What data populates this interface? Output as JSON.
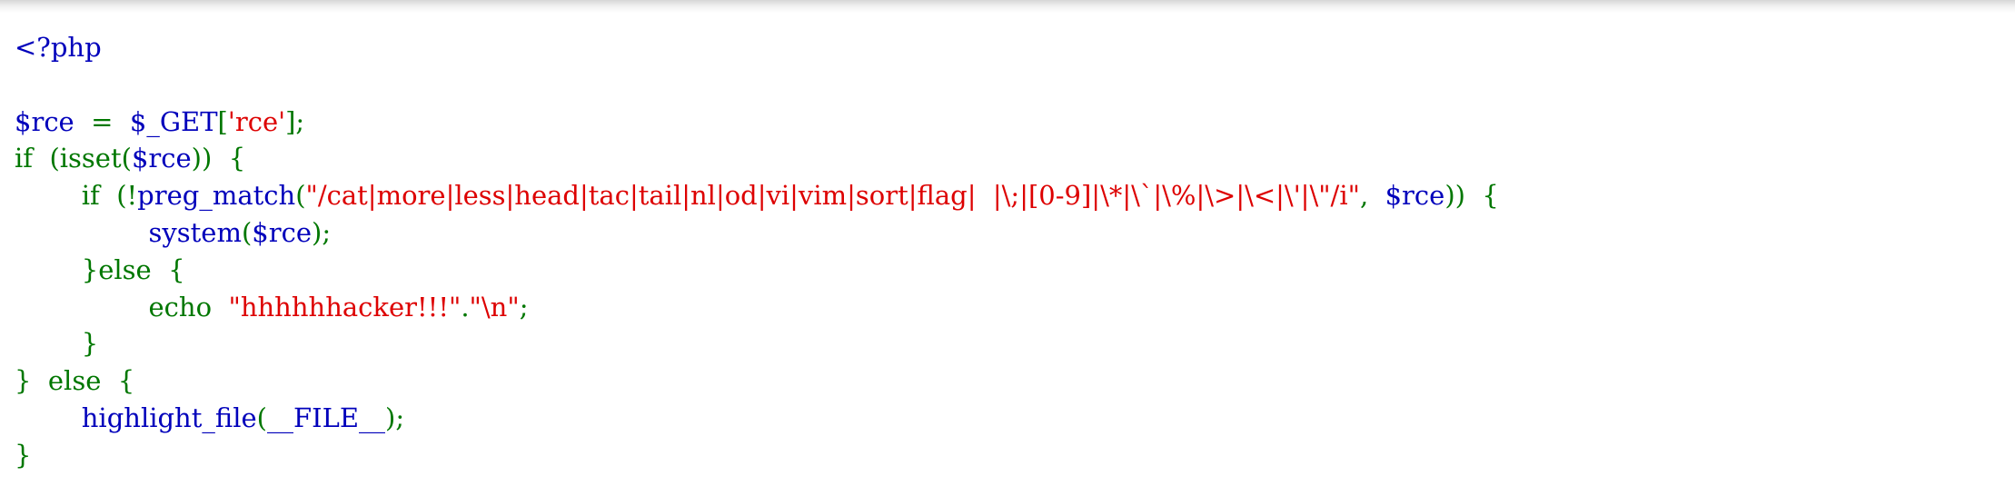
{
  "colors": {
    "default": "#0000BB",
    "keyword": "#007700",
    "string": "#DD0000"
  },
  "code": {
    "lines": [
      [
        {
          "text": "<?php",
          "type": "default"
        }
      ],
      [],
      [
        {
          "text": "$rce  ",
          "type": "default"
        },
        {
          "text": "=  ",
          "type": "keyword"
        },
        {
          "text": "$_GET",
          "type": "default"
        },
        {
          "text": "[",
          "type": "keyword"
        },
        {
          "text": "'rce'",
          "type": "string"
        },
        {
          "text": "];",
          "type": "keyword"
        }
      ],
      [
        {
          "text": "if  (isset(",
          "type": "keyword"
        },
        {
          "text": "$rce",
          "type": "default"
        },
        {
          "text": "))  {",
          "type": "keyword"
        }
      ],
      [
        {
          "text": "        if  (!",
          "type": "keyword"
        },
        {
          "text": "preg_match",
          "type": "default"
        },
        {
          "text": "(",
          "type": "keyword"
        },
        {
          "text": "\"/cat|more|less|head|tac|tail|nl|od|vi|vim|sort|flag|  |\\;|[0-9]|\\*|\\`|\\%|\\>|\\<|\\'|\\\"/i\"",
          "type": "string"
        },
        {
          "text": ",  ",
          "type": "keyword"
        },
        {
          "text": "$rce",
          "type": "default"
        },
        {
          "text": "))  {",
          "type": "keyword"
        }
      ],
      [
        {
          "text": "                ",
          "type": "keyword"
        },
        {
          "text": "system",
          "type": "default"
        },
        {
          "text": "(",
          "type": "keyword"
        },
        {
          "text": "$rce",
          "type": "default"
        },
        {
          "text": ");",
          "type": "keyword"
        }
      ],
      [
        {
          "text": "        }else  {",
          "type": "keyword"
        }
      ],
      [
        {
          "text": "                echo  ",
          "type": "keyword"
        },
        {
          "text": "\"hhhhhhacker!!!\"",
          "type": "string"
        },
        {
          "text": ".",
          "type": "keyword"
        },
        {
          "text": "\"\\n\"",
          "type": "string"
        },
        {
          "text": ";",
          "type": "keyword"
        }
      ],
      [
        {
          "text": "        }",
          "type": "keyword"
        }
      ],
      [
        {
          "text": "}  else  {",
          "type": "keyword"
        }
      ],
      [
        {
          "text": "        ",
          "type": "keyword"
        },
        {
          "text": "highlight_file",
          "type": "default"
        },
        {
          "text": "(",
          "type": "keyword"
        },
        {
          "text": "__FILE__",
          "type": "default"
        },
        {
          "text": ");",
          "type": "keyword"
        }
      ],
      [
        {
          "text": "}",
          "type": "keyword"
        }
      ]
    ]
  }
}
